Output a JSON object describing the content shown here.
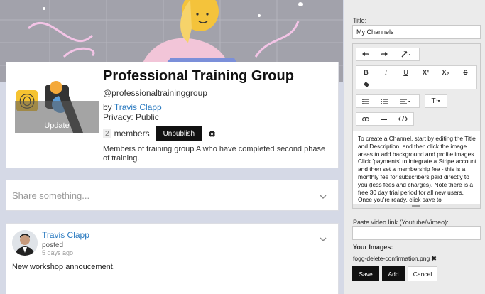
{
  "group": {
    "title": "Professional Training Group",
    "handle": "@professionaltraininggroup",
    "by_prefix": "by",
    "owner": "Travis Clapp",
    "privacy": "Privacy: Public",
    "member_count": "2",
    "members_label": "members",
    "unpublish_label": "Unpublish",
    "update_label": "Update",
    "description": "Members of training group A who have completed second phase of training."
  },
  "share": {
    "placeholder": "Share something..."
  },
  "post": {
    "author": "Travis Clapp",
    "action": "posted",
    "time": "5 days ago",
    "body": "New workshop annoucement."
  },
  "sidebar": {
    "title_label": "Title:",
    "title_value": "My Channels",
    "toolbar": {
      "superscript": "X²",
      "subscript": "X₂",
      "heading": "T"
    },
    "editor_text": "To create a Channel, start by editing the Title and Description, and then click the image areas to add background and profile images. Click 'payments' to integrate a Stripe account and then set a membership fee - this is a monthly fee for subscribers paid directly to you (less fees and charges). Note there is a free 30 day trial period for all new users. Once you're ready, click save to",
    "video_label": "Paste video link (Youtube/Vimeo):",
    "video_value": "",
    "images_label": "Your Images:",
    "image_file": "fogg-delete-confirmation.png",
    "remove_mark": "✖",
    "save_label": "Save",
    "add_label": "Add",
    "cancel_label": "Cancel"
  },
  "colors": {
    "link": "#2a7ac0",
    "dark_button": "#111111",
    "page_bg": "#d5d9e6",
    "sidebar_bg": "#ebebeb"
  }
}
